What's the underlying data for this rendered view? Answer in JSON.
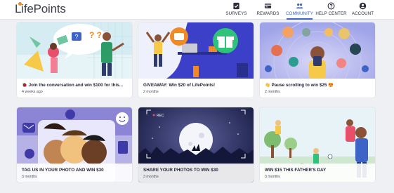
{
  "app": {
    "logo_text": "LifePoints"
  },
  "nav": {
    "items": [
      {
        "label": "SURVEYS",
        "icon": "survey-check-icon"
      },
      {
        "label": "REWARDS",
        "icon": "rewards-card-icon"
      },
      {
        "label": "COMMUNITY",
        "icon": "community-people-icon",
        "active": true
      },
      {
        "label": "HELP CENTER",
        "icon": "help-question-icon"
      },
      {
        "label": "ACCOUNT",
        "icon": "account-user-icon"
      }
    ]
  },
  "colors": {
    "brand_accent": "#f08a24",
    "nav_active": "#3e63c7"
  },
  "cards": [
    {
      "title": "🐞 Join the conversation and win $100 for this...",
      "date": "4 weeks ago"
    },
    {
      "title": "GIVEAWAY: Win $20 of LifePoints!",
      "date": "2 months"
    },
    {
      "title": "👋 Pause scrolling to win $25 😍",
      "date": "2 months"
    },
    {
      "title": "TAG US IN YOUR PHOTO AND WIN $30",
      "date": "3 months"
    },
    {
      "title": "SHARE YOUR PHOTOS TO WIN $30",
      "date": "3 months"
    },
    {
      "title": "WIN $15 THIS FATHER'S DAY",
      "date": "3 months"
    }
  ],
  "card_art": {
    "card1": {
      "sticker_text": "?",
      "marks": "? ?"
    },
    "card5": {
      "rec_label": "REC"
    }
  }
}
